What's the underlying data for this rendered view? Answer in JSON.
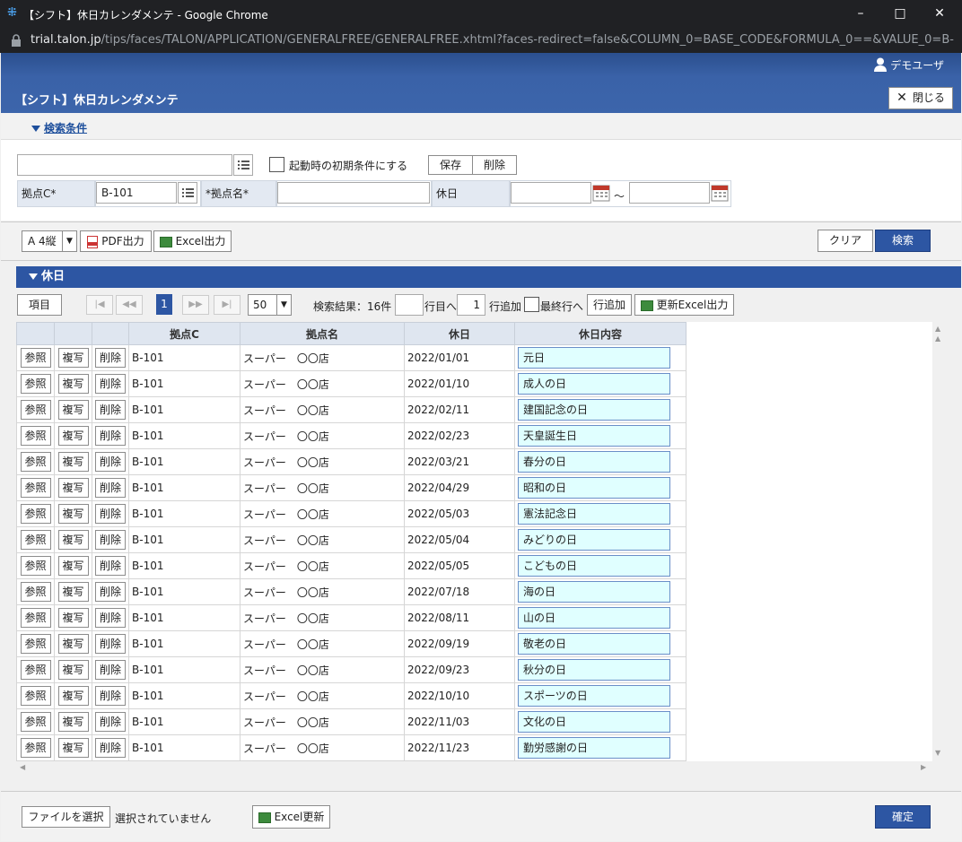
{
  "window": {
    "title": "【シフト】休日カレンダメンテ - Google Chrome",
    "url_host": "trial.talon.jp",
    "url_path": "/tips/faces/TALON/APPLICATION/GENERALFREE/GENERALFREE.xhtml?faces-redirect=false&COLUMN_0=BASE_CODE&FORMULA_0==&VALUE_0=B-10..."
  },
  "header": {
    "user": "デモユーザ",
    "page_title": "【シフト】休日カレンダメンテ",
    "close_label": "閉じる"
  },
  "search": {
    "section_label": "検索条件",
    "condition_name": "",
    "initial_checkbox_label": "起動時の初期条件にする",
    "save_label": "保存",
    "delete_label": "削除",
    "base_code_label": "拠点C*",
    "base_code_value": "B-101",
    "base_name_label": "*拠点名*",
    "base_name_value": "",
    "holiday_label": "休日",
    "date_from": "",
    "date_sep": "～",
    "date_to": ""
  },
  "toolbar": {
    "paper": "A 4縦",
    "pdf_label": "PDF出力",
    "excel_label": "Excel出力",
    "clear_label": "クリア",
    "search_label": "検索"
  },
  "results": {
    "section_label": "休日",
    "items_label": "項目",
    "page": "1",
    "page_size": "50",
    "result_count": "検索結果：16件",
    "goto_row_value": "",
    "goto_row_label": "行目へ",
    "add_count": "1",
    "add_row_label": "行追加",
    "last_row_label": "最終行へ",
    "add_row_button": "行追加",
    "update_excel_label": "更新Excel出力",
    "columns": [
      "拠点C",
      "拠点名",
      "休日",
      "休日内容"
    ],
    "row_buttons": [
      "参照",
      "複写",
      "削除"
    ],
    "rows": [
      {
        "code": "B-101",
        "name": "スーパー　〇〇店",
        "date": "2022/01/01",
        "content": "元日"
      },
      {
        "code": "B-101",
        "name": "スーパー　〇〇店",
        "date": "2022/01/10",
        "content": "成人の日"
      },
      {
        "code": "B-101",
        "name": "スーパー　〇〇店",
        "date": "2022/02/11",
        "content": "建国記念の日"
      },
      {
        "code": "B-101",
        "name": "スーパー　〇〇店",
        "date": "2022/02/23",
        "content": "天皇誕生日"
      },
      {
        "code": "B-101",
        "name": "スーパー　〇〇店",
        "date": "2022/03/21",
        "content": "春分の日"
      },
      {
        "code": "B-101",
        "name": "スーパー　〇〇店",
        "date": "2022/04/29",
        "content": "昭和の日"
      },
      {
        "code": "B-101",
        "name": "スーパー　〇〇店",
        "date": "2022/05/03",
        "content": "憲法記念日"
      },
      {
        "code": "B-101",
        "name": "スーパー　〇〇店",
        "date": "2022/05/04",
        "content": "みどりの日"
      },
      {
        "code": "B-101",
        "name": "スーパー　〇〇店",
        "date": "2022/05/05",
        "content": "こどもの日"
      },
      {
        "code": "B-101",
        "name": "スーパー　〇〇店",
        "date": "2022/07/18",
        "content": "海の日"
      },
      {
        "code": "B-101",
        "name": "スーパー　〇〇店",
        "date": "2022/08/11",
        "content": "山の日"
      },
      {
        "code": "B-101",
        "name": "スーパー　〇〇店",
        "date": "2022/09/19",
        "content": "敬老の日"
      },
      {
        "code": "B-101",
        "name": "スーパー　〇〇店",
        "date": "2022/09/23",
        "content": "秋分の日"
      },
      {
        "code": "B-101",
        "name": "スーパー　〇〇店",
        "date": "2022/10/10",
        "content": "スポーツの日"
      },
      {
        "code": "B-101",
        "name": "スーパー　〇〇店",
        "date": "2022/11/03",
        "content": "文化の日"
      },
      {
        "code": "B-101",
        "name": "スーパー　〇〇店",
        "date": "2022/11/23",
        "content": "勤労感謝の日"
      }
    ]
  },
  "footer": {
    "file_select_label": "ファイルを選択",
    "no_file_label": "選択されていません",
    "excel_update_label": "Excel更新",
    "confirm_label": "確定"
  }
}
